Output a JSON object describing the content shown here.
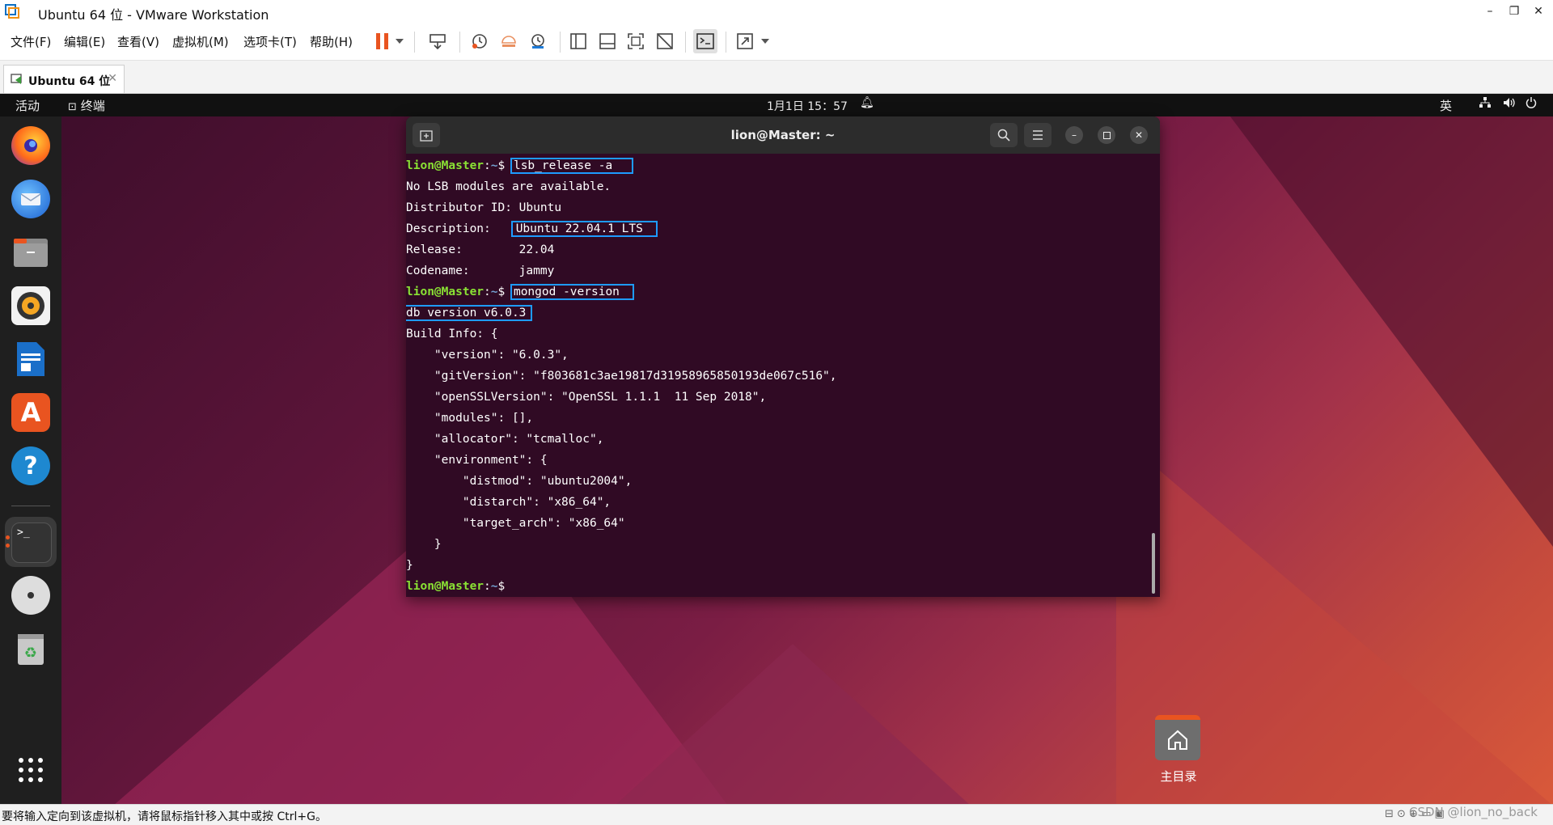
{
  "window": {
    "title": "Ubuntu 64 位 - VMware Workstation",
    "controls": [
      "–",
      "❐",
      "✕"
    ]
  },
  "menu": {
    "items": [
      "文件(F)",
      "编辑(E)",
      "查看(V)",
      "虚拟机(M)",
      "选项卡(T)",
      "帮助(H)"
    ]
  },
  "tabs": [
    {
      "label": "Ubuntu 64 位",
      "close": "✕"
    }
  ],
  "guest": {
    "topbar": {
      "activities": "活动",
      "app": "终端",
      "clock": "1月1日  15：57",
      "ime": "英"
    },
    "terminal": {
      "title": "lion@Master: ~",
      "prompt_user": "lion@Master",
      "prompt_colon": ":",
      "prompt_path": "~",
      "prompt_sym": "$ ",
      "cmd1": "lsb_release -a",
      "out1": [
        "No LSB modules are available.",
        "Distributor ID: Ubuntu"
      ],
      "desc_label": "Description:    ",
      "desc_value": "Ubuntu 22.04.1 LTS",
      "out2": [
        "Release:        22.04",
        "Codename:       jammy"
      ],
      "cmd2": "mongod -version",
      "dbversion": "db version v6.0.3",
      "out3": [
        "Build Info: {",
        "    \"version\": \"6.0.3\",",
        "    \"gitVersion\": \"f803681c3ae19817d31958965850193de067c516\",",
        "    \"openSSLVersion\": \"OpenSSL 1.1.1  11 Sep 2018\",",
        "    \"modules\": [],",
        "    \"allocator\": \"tcmalloc\",",
        "    \"environment\": {",
        "        \"distmod\": \"ubuntu2004\",",
        "        \"distarch\": \"x86_64\",",
        "        \"target_arch\": \"x86_64\"",
        "    }",
        "}"
      ]
    },
    "desktop": {
      "home_label": "主目录"
    }
  },
  "statusbar": {
    "message": "要将输入定向到该虚拟机，请将鼠标指针移入其中或按 Ctrl+G。",
    "watermark": "CSDN @lion_no_back"
  },
  "colors": {
    "ubuntu_orange": "#e95420",
    "terminal_bg": "#300a24",
    "highlight": "#1e9bff",
    "pause": "#e95420"
  }
}
